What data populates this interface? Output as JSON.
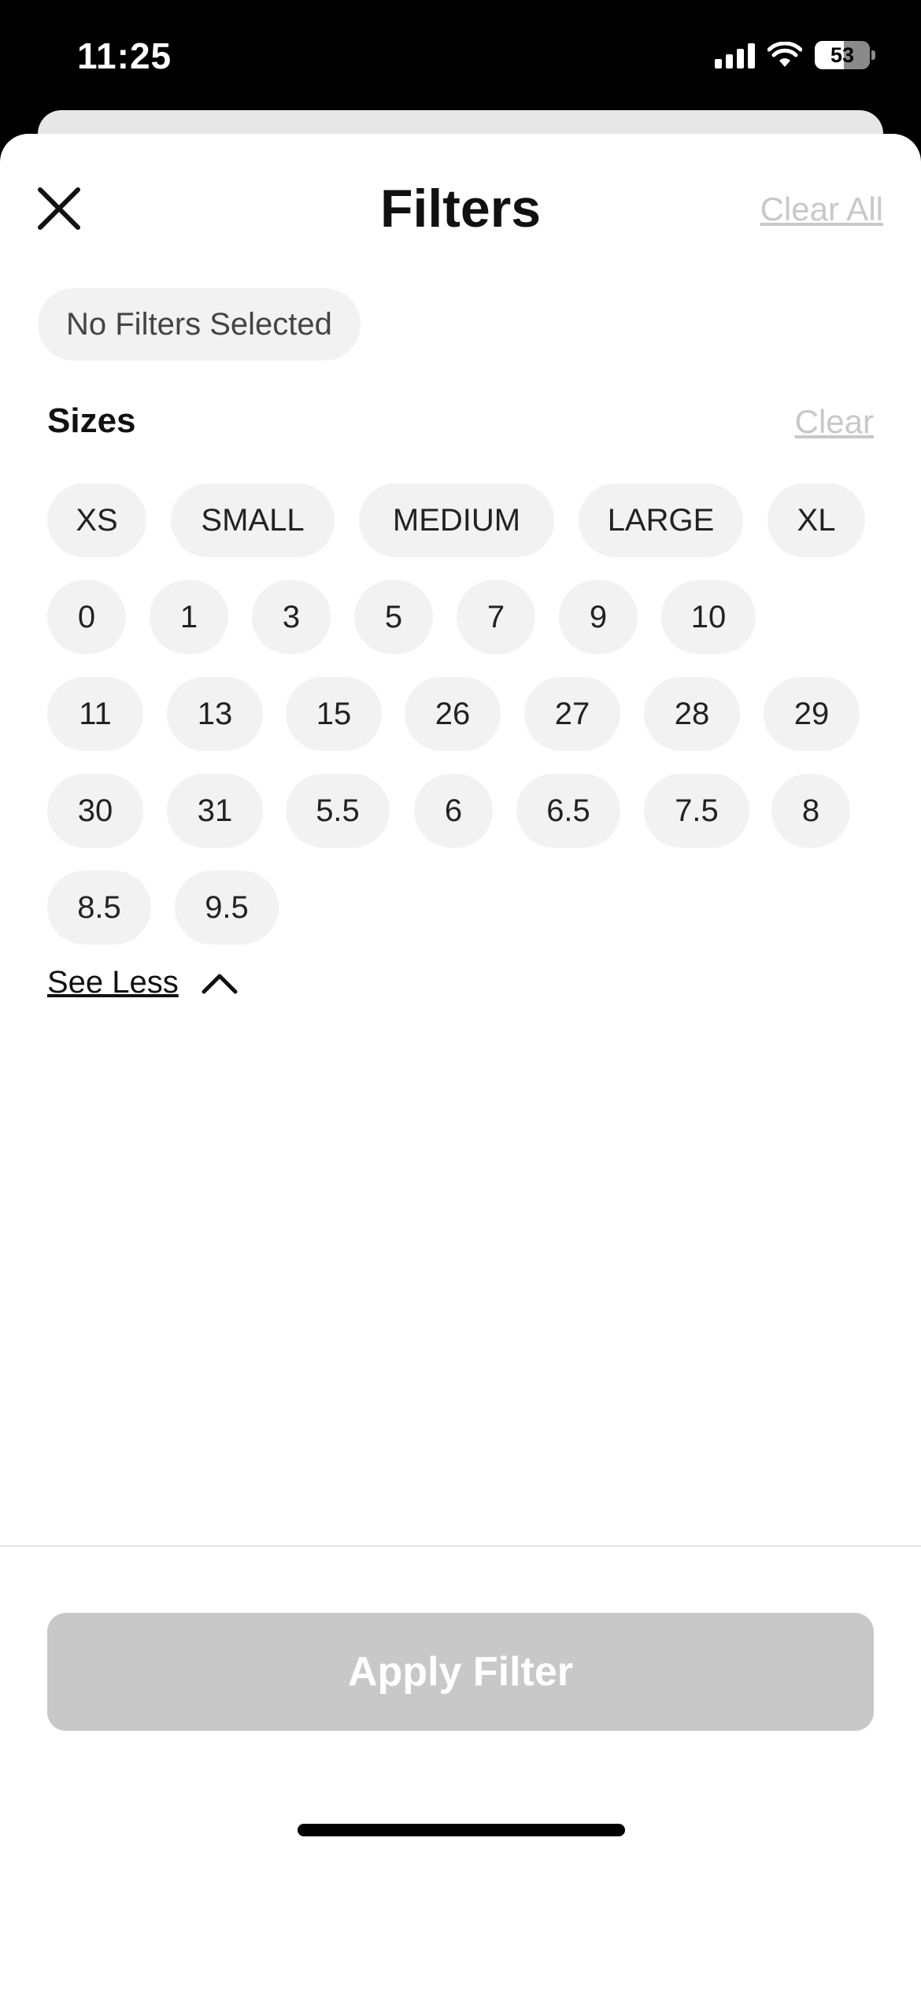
{
  "status_bar": {
    "time": "11:25",
    "battery": "53"
  },
  "header": {
    "title": "Filters",
    "clear_all_label": "Clear All"
  },
  "selected_summary": "No Filters Selected",
  "sizes": {
    "title": "Sizes",
    "clear_label": "Clear",
    "rows": [
      [
        "XS",
        "SMALL",
        "MEDIUM",
        "LARGE",
        "XL"
      ],
      [
        "0",
        "1",
        "3",
        "5",
        "7",
        "9",
        "10"
      ],
      [
        "11",
        "13",
        "15",
        "26",
        "27",
        "28",
        "29"
      ],
      [
        "30",
        "31",
        "5.5",
        "6",
        "6.5",
        "7.5",
        "8"
      ],
      [
        "8.5",
        "9.5"
      ]
    ],
    "see_less_label": "See Less"
  },
  "footer": {
    "apply_label": "Apply Filter"
  }
}
